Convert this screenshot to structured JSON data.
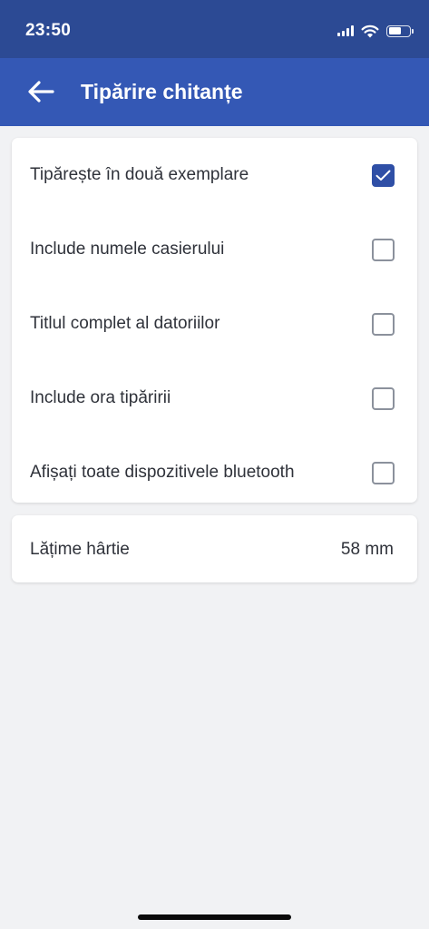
{
  "status_bar": {
    "time": "23:50",
    "icons": [
      "cellular-signal-icon",
      "wifi-icon",
      "battery-icon"
    ]
  },
  "header": {
    "back_icon": "arrow-left-icon",
    "title": "Tipărire chitanțe"
  },
  "options": [
    {
      "label": "Tipărește în două exemplare",
      "checked": true
    },
    {
      "label": "Include numele casierului",
      "checked": false
    },
    {
      "label": "Titlul complet al datoriilor",
      "checked": false
    },
    {
      "label": "Include ora tipăririi",
      "checked": false
    },
    {
      "label": "Afișați toate dispozitivele bluetooth",
      "checked": false
    }
  ],
  "paper": {
    "label": "Lățime hârtie",
    "value": "58 mm"
  },
  "colors": {
    "status_bar": "#2c4a94",
    "app_bar": "#3458b5",
    "checkbox_checked": "#2f4fa6",
    "background": "#f1f2f4"
  }
}
